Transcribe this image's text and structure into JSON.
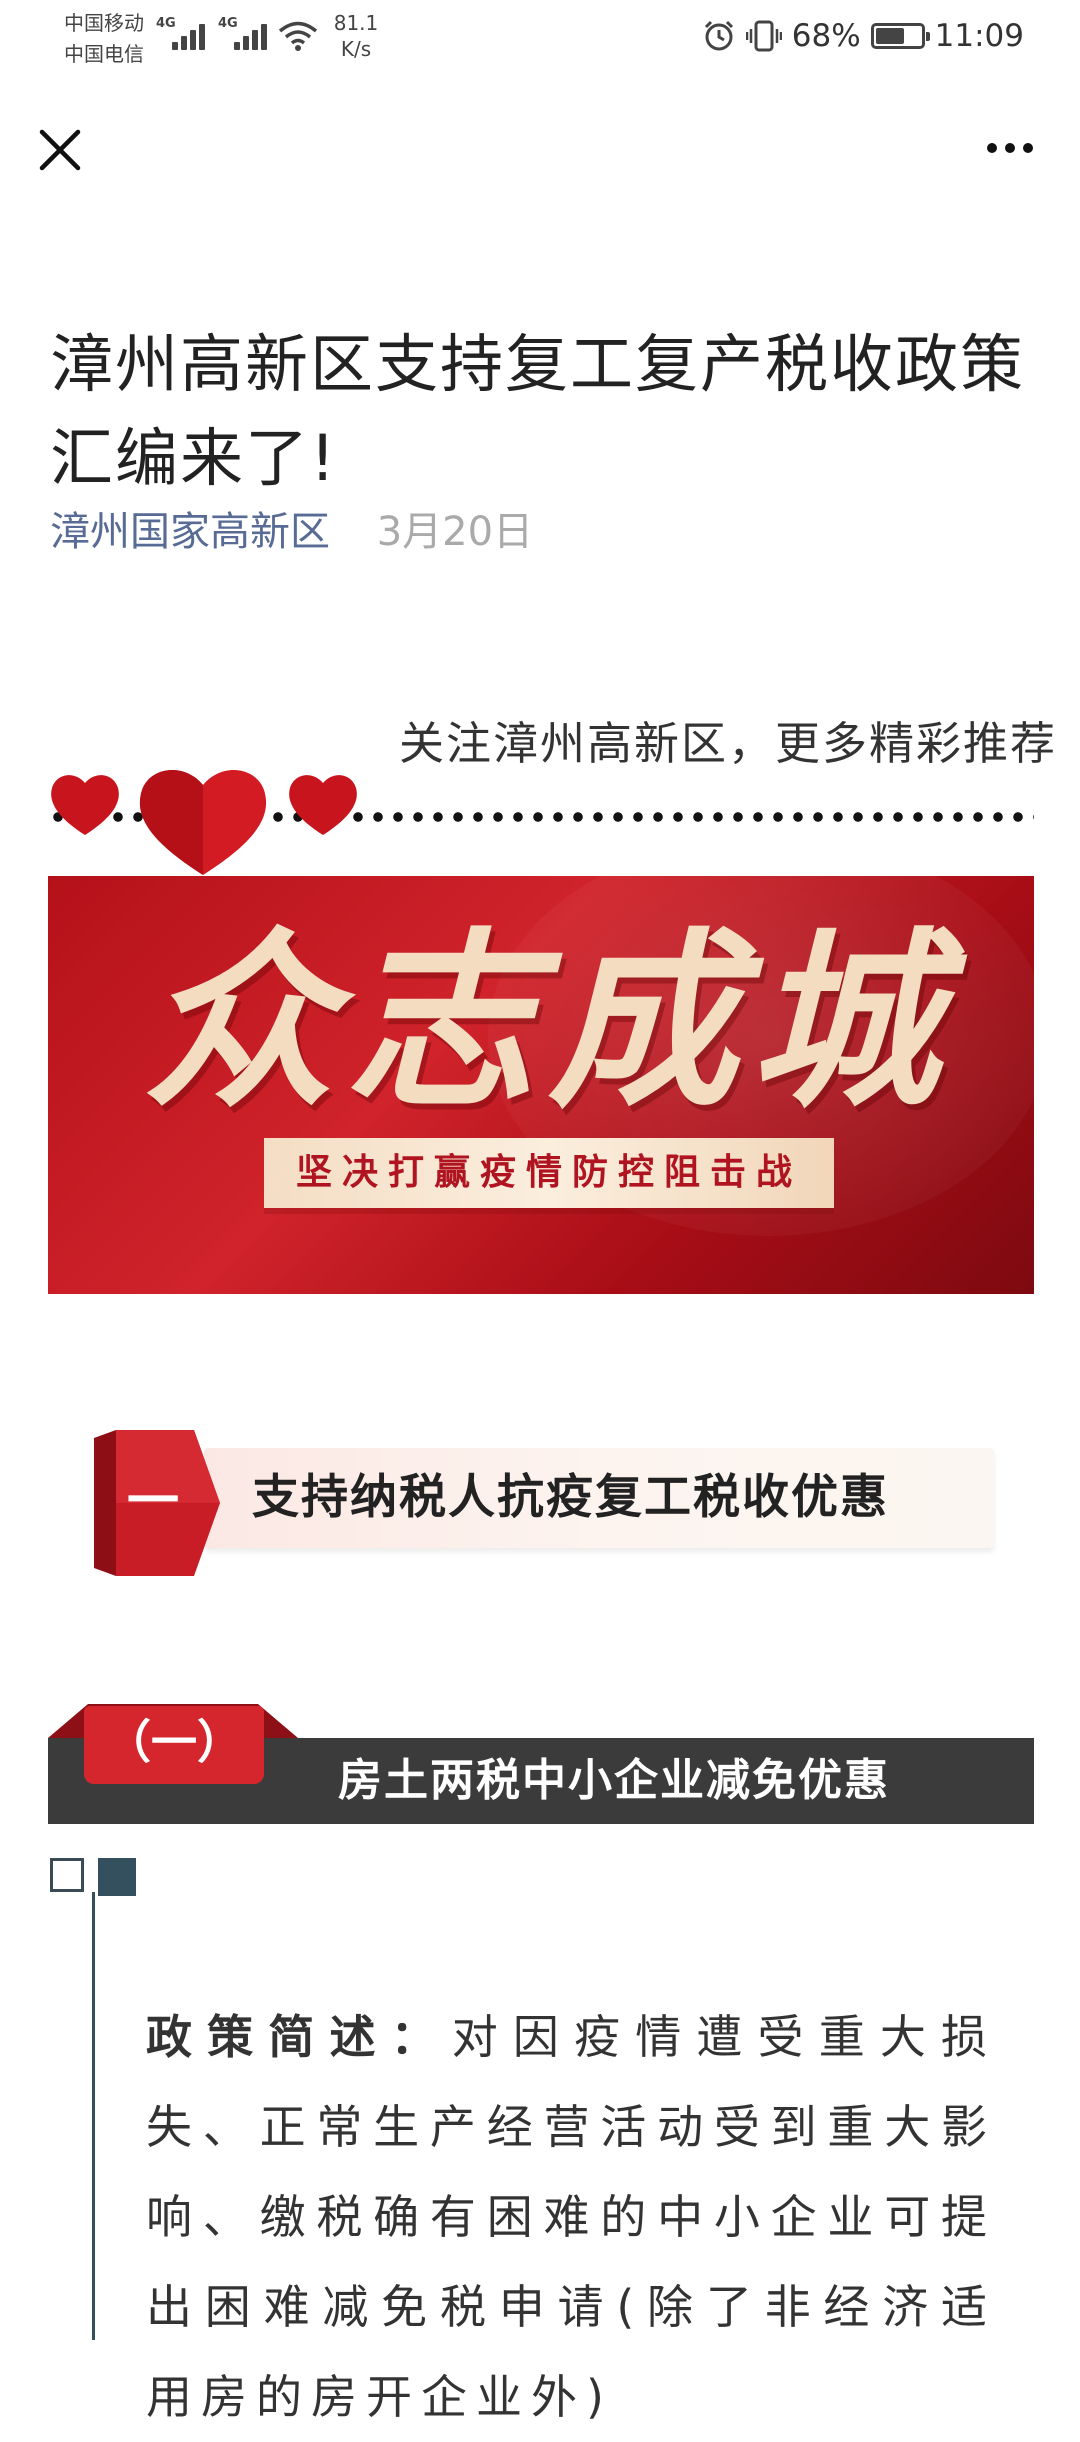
{
  "status_bar": {
    "carrier1": "中国移动",
    "carrier2": "中国电信",
    "net1": "4G",
    "net2": "4G",
    "speed_value": "81.1",
    "speed_unit": "K/s",
    "battery": "68%",
    "battery_level": 0.68,
    "time": "11:09"
  },
  "article": {
    "title": "漳州高新区支持复工复产税收政策汇编来了!",
    "author": "漳州国家高新区",
    "date": "3月20日"
  },
  "follow_banner": {
    "text": "关注漳州高新区，更多精彩推荐"
  },
  "banner": {
    "calligraphy": "众志成城",
    "slogan": "坚决打赢疫情防控阻击战"
  },
  "section": {
    "number": "一",
    "title": "支持纳税人抗疫复工税收优惠"
  },
  "subsection": {
    "number": "（一）",
    "title": "房土两税中小企业减免优惠"
  },
  "policy": {
    "label": "政策简述：",
    "text": "对因疫情遭受重大损失、正常生产经营活动受到重大影响、缴税确有困难的中小企业可提出困难减免税申请(除了非经济适用房的房开企业外)"
  },
  "colors": {
    "author_link": "#576b95",
    "banner_red": "#c51a22",
    "sub_bar": "#3b3b3b",
    "accent_teal": "#34505f"
  }
}
